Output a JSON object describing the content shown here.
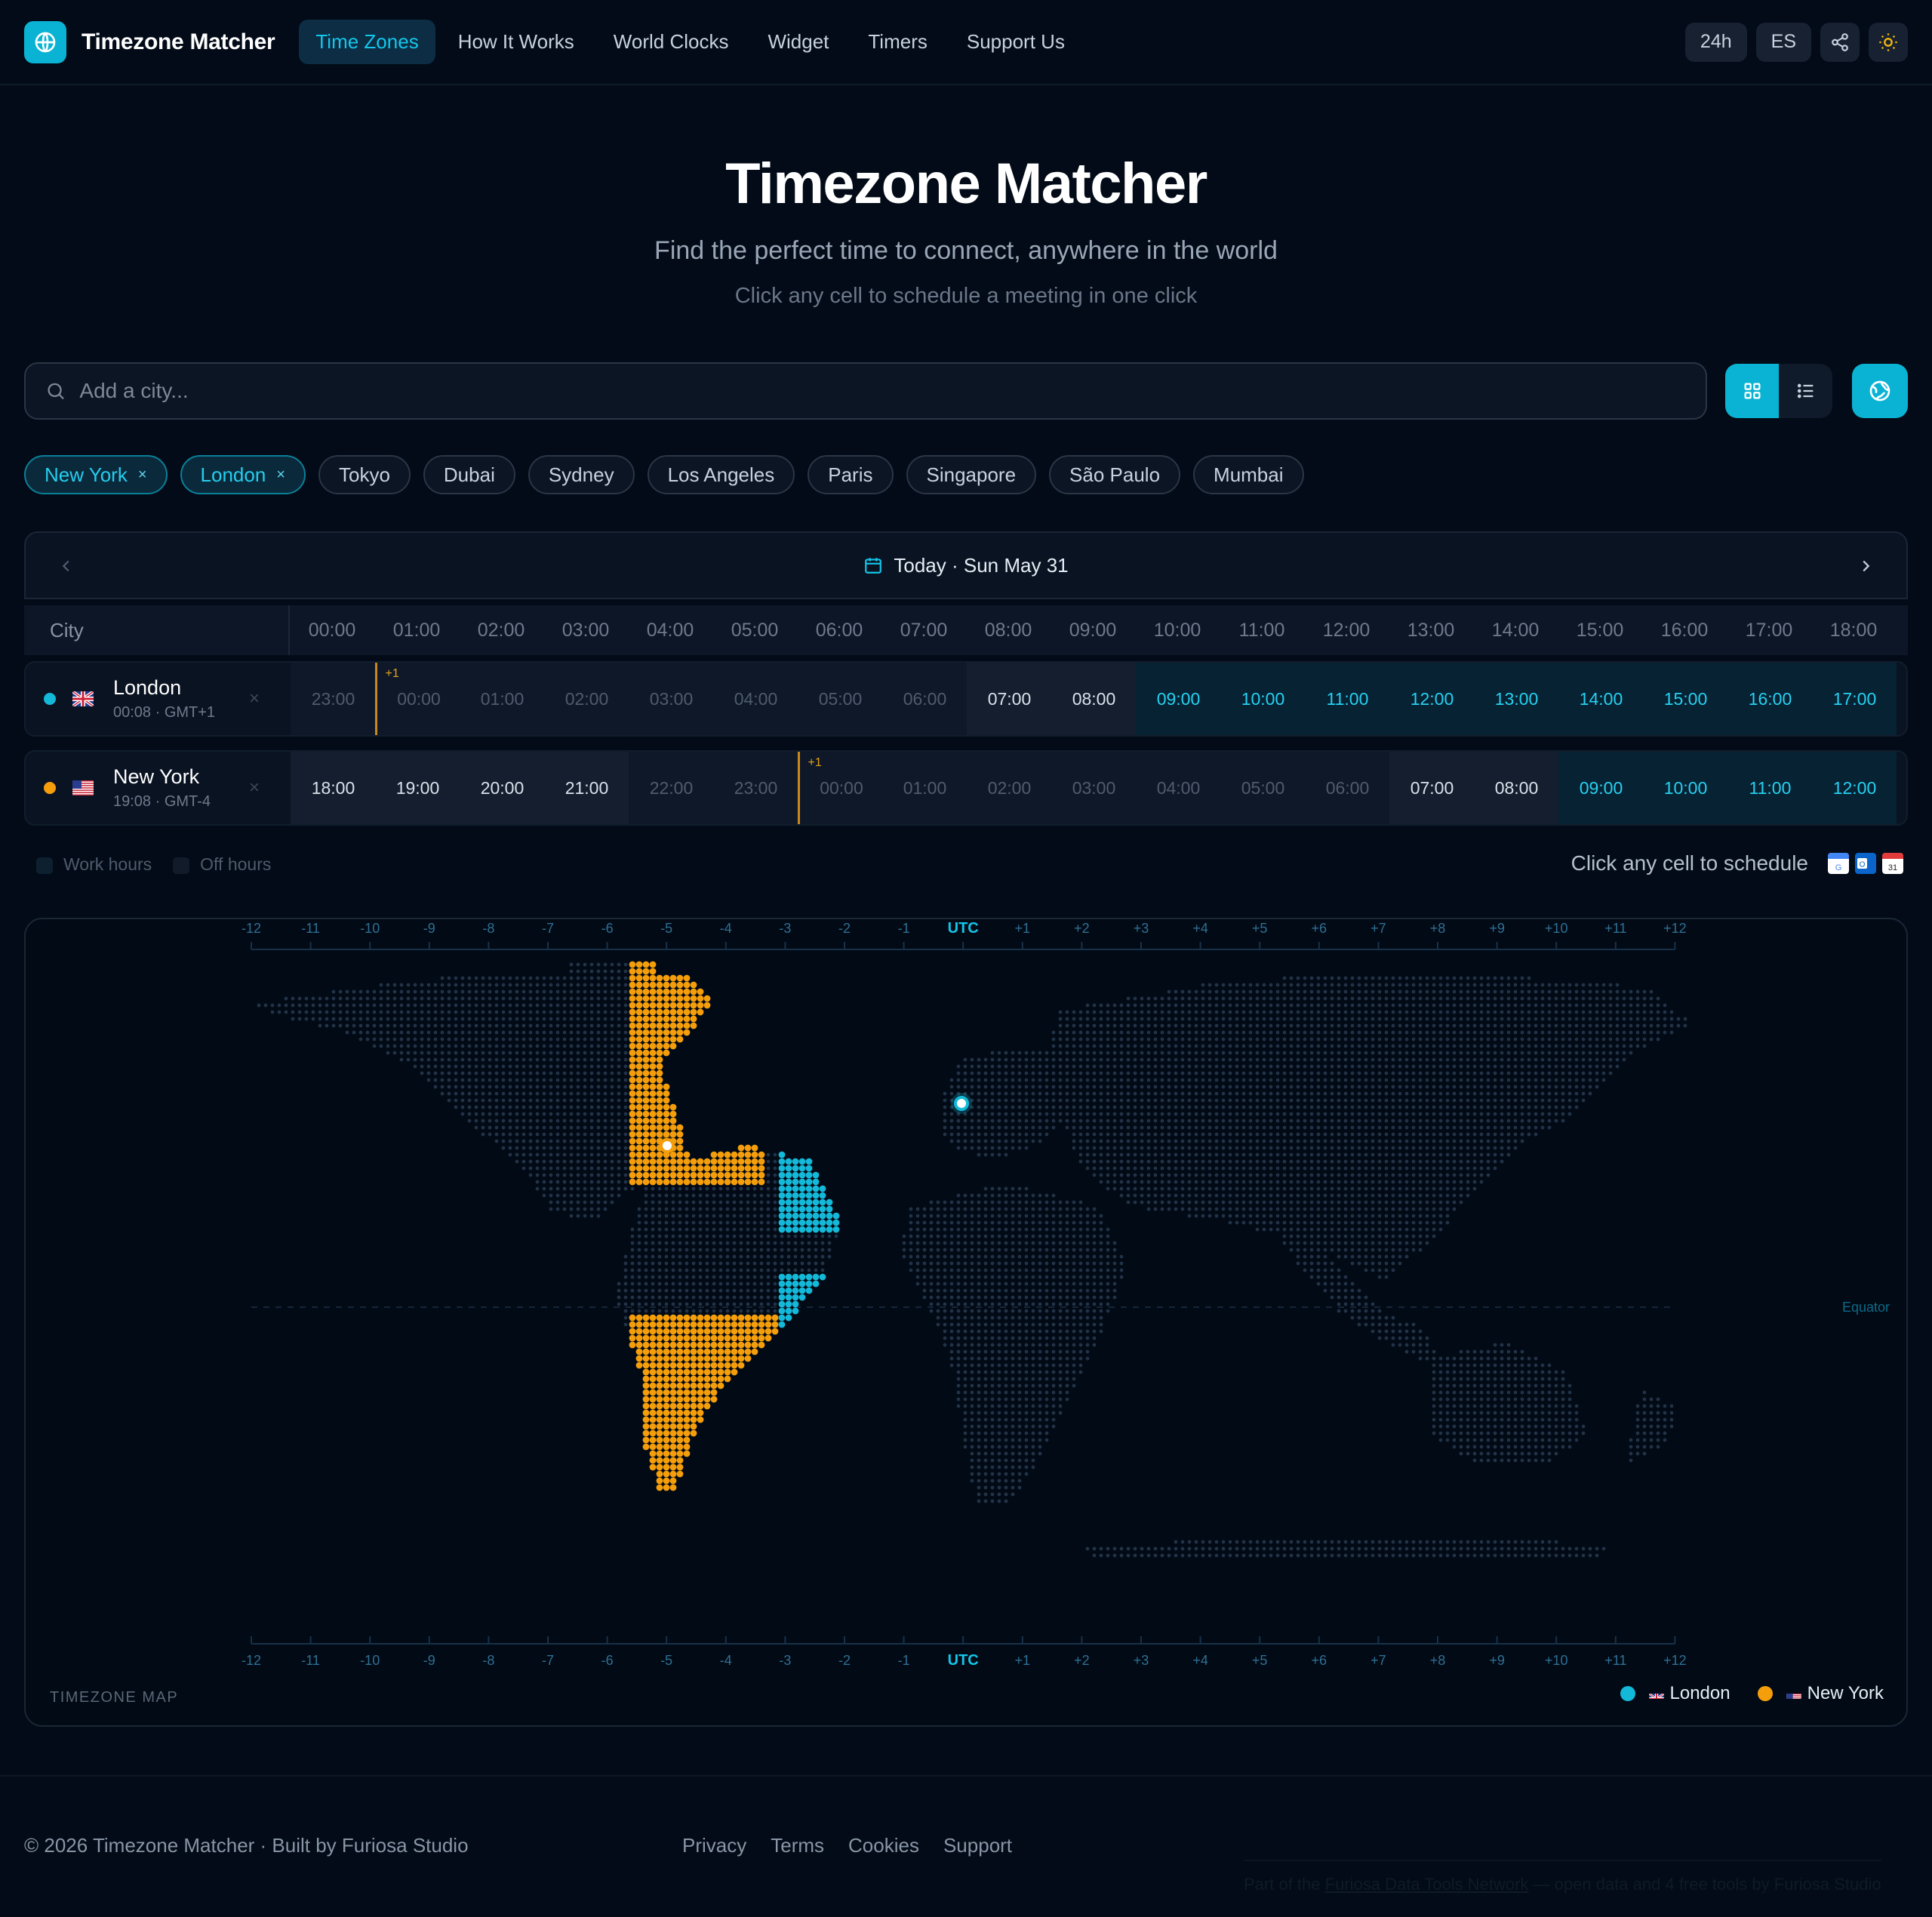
{
  "nav": {
    "brand": "Timezone Matcher",
    "links": [
      "Time Zones",
      "How It Works",
      "World Clocks",
      "Widget",
      "Timers",
      "Support Us"
    ],
    "active": 0,
    "format_btn": "24h",
    "lang_btn": "ES"
  },
  "hero": {
    "title": "Timezone Matcher",
    "subtitle": "Find the perfect time to connect, anywhere in the world",
    "hint": "Click any cell to schedule a meeting in one click"
  },
  "search": {
    "placeholder": "Add a city..."
  },
  "chips": [
    {
      "label": "New York",
      "selected": true
    },
    {
      "label": "London",
      "selected": true
    },
    {
      "label": "Tokyo",
      "selected": false
    },
    {
      "label": "Dubai",
      "selected": false
    },
    {
      "label": "Sydney",
      "selected": false
    },
    {
      "label": "Los Angeles",
      "selected": false
    },
    {
      "label": "Paris",
      "selected": false
    },
    {
      "label": "Singapore",
      "selected": false
    },
    {
      "label": "São Paulo",
      "selected": false
    },
    {
      "label": "Mumbai",
      "selected": false
    }
  ],
  "chip_close": "×",
  "date": {
    "label": "Today · Sun May 31"
  },
  "grid": {
    "city_header": "City",
    "hours": [
      "00:00",
      "01:00",
      "02:00",
      "03:00",
      "04:00",
      "05:00",
      "06:00",
      "07:00",
      "08:00",
      "09:00",
      "10:00",
      "11:00",
      "12:00",
      "13:00",
      "14:00",
      "15:00",
      "16:00",
      "17:00",
      "18:00"
    ],
    "rows": [
      {
        "name": "London",
        "time": "00:08 · GMT+1",
        "dot": "#14b8d8",
        "flag": "uk",
        "cells": [
          "23:00",
          "00:00",
          "01:00",
          "02:00",
          "03:00",
          "04:00",
          "05:00",
          "06:00",
          "07:00",
          "08:00",
          "09:00",
          "10:00",
          "11:00",
          "12:00",
          "13:00",
          "14:00",
          "15:00",
          "16:00",
          "17:00"
        ],
        "kinds": [
          "night",
          "night",
          "night",
          "night",
          "night",
          "night",
          "night",
          "night",
          "edge",
          "edge",
          "work",
          "work",
          "work",
          "work",
          "work",
          "work",
          "work",
          "work",
          "work"
        ],
        "midnight_index": 1
      },
      {
        "name": "New York",
        "time": "19:08 · GMT-4",
        "dot": "#f59e0b",
        "flag": "us",
        "cells": [
          "18:00",
          "19:00",
          "20:00",
          "21:00",
          "22:00",
          "23:00",
          "00:00",
          "01:00",
          "02:00",
          "03:00",
          "04:00",
          "05:00",
          "06:00",
          "07:00",
          "08:00",
          "09:00",
          "10:00",
          "11:00",
          "12:00"
        ],
        "kinds": [
          "edge",
          "edge",
          "edge",
          "edge",
          "night",
          "night",
          "night",
          "night",
          "night",
          "night",
          "night",
          "night",
          "night",
          "edge",
          "edge",
          "work",
          "work",
          "work",
          "work"
        ],
        "midnight_index": 6
      }
    ],
    "next_day_badge": "+1",
    "close_glyph": "×"
  },
  "legend": {
    "work": "Work hours",
    "off": "Off hours",
    "schedule": "Click any cell to schedule"
  },
  "map": {
    "title": "TIMEZONE MAP",
    "utc_labels": [
      "-12",
      "-11",
      "-10",
      "-9",
      "-8",
      "-7",
      "-6",
      "-5",
      "-4",
      "-3",
      "-2",
      "-1",
      "UTC",
      "+1",
      "+2",
      "+3",
      "+4",
      "+5",
      "+6",
      "+7",
      "+8",
      "+9",
      "+10",
      "+11",
      "+12"
    ],
    "equator": "Equator",
    "legend": [
      {
        "name": "London",
        "color": "#14b8d8",
        "flag": "uk"
      },
      {
        "name": "New York",
        "color": "#f59e0b",
        "flag": "us"
      }
    ]
  },
  "footer": {
    "copy": "© 2026 Timezone Matcher · Built by Furiosa Studio",
    "links": [
      "Privacy",
      "Terms",
      "Cookies",
      "Support"
    ],
    "network_prefix": "Part of the ",
    "network_link": "Furiosa Data Tools Network",
    "network_suffix": " — open data and 4 free tools by Furiosa Studio"
  },
  "colors": {
    "accent": "#0ab3d3",
    "london": "#14b8d8",
    "newyork": "#f59e0b",
    "background": "#020b17"
  }
}
